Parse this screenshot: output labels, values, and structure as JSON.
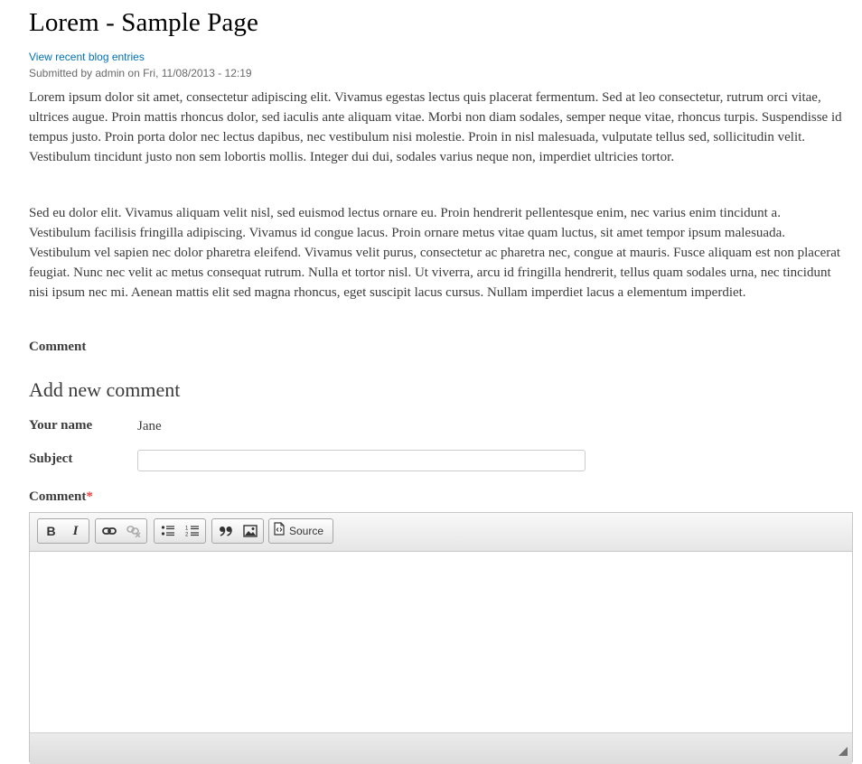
{
  "page": {
    "title": "Lorem - Sample Page",
    "blog_link": "View recent blog entries",
    "submitted": "Submitted by admin on Fri, 11/08/2013 - 12:19"
  },
  "content": {
    "paragraphs": [
      "Lorem ipsum dolor sit amet, consectetur adipiscing elit. Vivamus egestas lectus quis placerat fermentum. Sed at leo consectetur, rutrum orci vitae, ultrices augue. Proin mattis rhoncus dolor, sed iaculis ante aliquam vitae. Morbi non diam sodales, semper neque vitae, rhoncus turpis. Suspendisse id tempus justo. Proin porta dolor nec lectus dapibus, nec vestibulum nisi molestie. Proin in nisl malesuada, vulputate tellus sed, sollicitudin velit. Vestibulum tincidunt justo non sem lobortis mollis. Integer dui dui, sodales varius neque non, imperdiet ultricies tortor.",
      "Sed eu dolor elit. Vivamus aliquam velit nisl, sed euismod lectus ornare eu. Proin hendrerit pellentesque enim, nec varius enim tincidunt a. Vestibulum facilisis fringilla adipiscing. Vivamus id congue lacus. Proin ornare metus vitae quam luctus, sit amet tempor ipsum malesuada. Vestibulum vel sapien nec dolor pharetra eleifend. Vivamus velit purus, consectetur ac pharetra nec, congue at mauris. Fusce aliquam est non placerat feugiat. Nunc nec velit ac metus consequat rutrum. Nulla et tortor nisl. Ut viverra, arcu id fringilla hendrerit, tellus quam sodales urna, nec tincidunt nisi ipsum nec mi. Aenean mattis elit sed magna rhoncus, eget suscipit lacus cursus. Nullam imperdiet lacus a elementum imperdiet."
    ]
  },
  "comments": {
    "heading": "Comment"
  },
  "form": {
    "title": "Add new comment",
    "name_label": "Your name",
    "name_value": "Jane",
    "subject_label": "Subject",
    "subject_value": "",
    "subject_placeholder": "",
    "comment_label": "Comment",
    "required_marker": "*"
  },
  "editor": {
    "toolbar": {
      "bold": "B",
      "italic": "I",
      "source_label": "Source"
    },
    "icons": [
      "bold-icon",
      "italic-icon",
      "link-icon",
      "unlink-icon",
      "bulleted-list-icon",
      "numbered-list-icon",
      "blockquote-icon",
      "image-icon",
      "source-icon"
    ],
    "content": ""
  },
  "colors": {
    "link": "#0071b3",
    "required": "#ee3d3d",
    "text": "#3b3b3b"
  }
}
